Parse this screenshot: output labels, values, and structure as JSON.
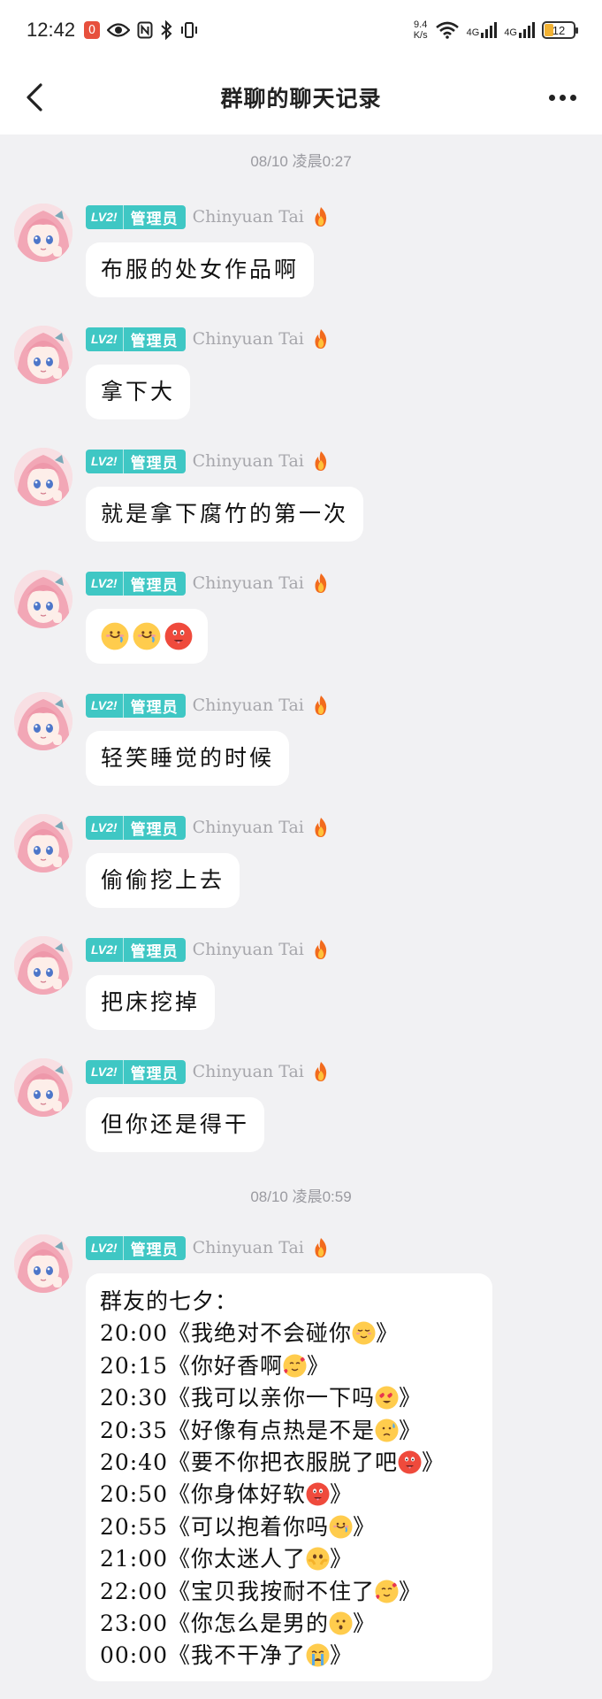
{
  "status_bar": {
    "time": "12:42",
    "notification_count": "0",
    "net_speed_value": "9.4",
    "net_speed_unit": "K/s",
    "signal_1": "4G",
    "signal_2": "4G",
    "battery": "12"
  },
  "header": {
    "title": "群聊的聊天记录"
  },
  "sender": {
    "level": "LV2!",
    "role": "管理员",
    "name": "Chinyuan Tai"
  },
  "dividers": [
    "08/10 凌晨0:27",
    "08/10 凌晨0:59"
  ],
  "messages": [
    {
      "text": "布服的处女作品啊"
    },
    {
      "text": "拿下大"
    },
    {
      "text": "就是拿下腐竹的第一次"
    },
    {
      "text": "",
      "emojis": [
        "drool-face-emoji",
        "drool-face-emoji",
        "hot-face-emoji"
      ]
    },
    {
      "text": "轻笑睡觉的时候"
    },
    {
      "text": "偷偷挖上去"
    },
    {
      "text": "把床挖掉"
    },
    {
      "text": "但你还是得干"
    }
  ],
  "long_message": {
    "lines": [
      {
        "text": "群友的七夕：",
        "emoji": ""
      },
      {
        "text": "20:00《我绝对不会碰你",
        "emoji": "relieved-face-emoji"
      },
      {
        "text": "20:15《你好香啊",
        "emoji": "smiling-hearts-emoji"
      },
      {
        "text": "20:30《我可以亲你一下吗",
        "emoji": "heart-eyes-emoji"
      },
      {
        "text": "20:35《好像有点热是不是",
        "emoji": "sweat-face-emoji"
      },
      {
        "text": "20:40《要不你把衣服脱了吧",
        "emoji": "hot-face-emoji"
      },
      {
        "text": "20:50《你身体好软",
        "emoji": "hot-face-emoji"
      },
      {
        "text": "20:55《可以抱着你吗",
        "emoji": "drool-face-emoji"
      },
      {
        "text": "21:00《你太迷人了",
        "emoji": "holding-tears-emoji"
      },
      {
        "text": "22:00《宝贝我按耐不住了",
        "emoji": "smiling-hearts-emoji"
      },
      {
        "text": "23:00《你怎么是男的",
        "emoji": "hushed-face-emoji"
      },
      {
        "text": "00:00《我不干净了",
        "emoji": "crying-face-emoji"
      }
    ],
    "close_mark": "》"
  }
}
